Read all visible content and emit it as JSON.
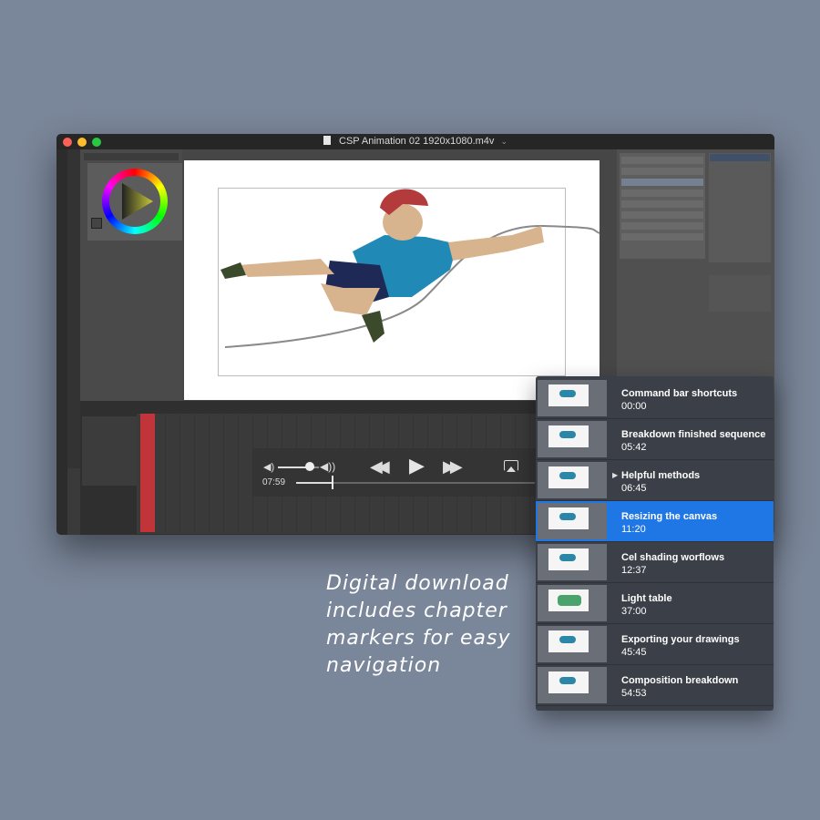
{
  "window": {
    "title": "CSP Animation 02 1920x1080.m4v",
    "colors": {
      "close": "#fe5f57",
      "minimize": "#febc2e",
      "maximize": "#28c840"
    }
  },
  "player": {
    "current_time": "07:59",
    "progress": 0.15,
    "volume": 0.8
  },
  "chapters": [
    {
      "title": "Command bar shortcuts",
      "time": "00:00",
      "active": false
    },
    {
      "title": "Breakdown finished sequence",
      "time": "05:42",
      "active": false
    },
    {
      "title": "Helpful methods",
      "time": "06:45",
      "active": false,
      "pointer": true
    },
    {
      "title": "Resizing the canvas",
      "time": "11:20",
      "active": true
    },
    {
      "title": "Cel shading worflows",
      "time": "12:37",
      "active": false
    },
    {
      "title": "Light table",
      "time": "37:00",
      "active": false
    },
    {
      "title": "Exporting your drawings",
      "time": "45:45",
      "active": false
    },
    {
      "title": "Composition breakdown",
      "time": "54:53",
      "active": false
    }
  ],
  "caption": {
    "lines": [
      "Digital download",
      "includes chapter",
      "markers for easy",
      "navigation"
    ]
  },
  "accent_color": "#1f77e6",
  "icons": [
    "document-icon",
    "volume-low-icon",
    "volume-high-icon",
    "rewind-icon",
    "play-icon",
    "fast-forward-icon",
    "airplay-icon"
  ]
}
